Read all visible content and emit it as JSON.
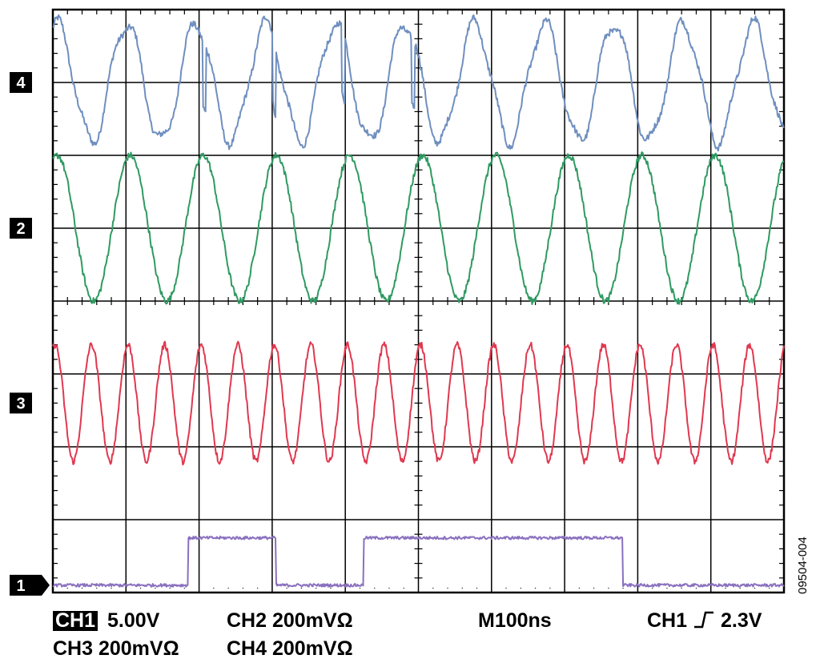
{
  "chart_data": {
    "type": "line",
    "instrument": "oscilloscope",
    "grid": true,
    "divisions": {
      "horizontal": 10,
      "vertical": 8
    },
    "series": [
      {
        "marker": "4",
        "color": "#6f8fbf",
        "waveform": "sine",
        "cycles_visible": 10.5,
        "amplitude_div": 0.8,
        "baseline_div": 7.0,
        "distortion": "glitches"
      },
      {
        "marker": "2",
        "color": "#2f9a62",
        "waveform": "sine",
        "cycles_visible": 10.0,
        "amplitude_div": 1.0,
        "baseline_div": 5.0
      },
      {
        "marker": "3",
        "color": "#e0384f",
        "waveform": "sine",
        "cycles_visible": 20.0,
        "amplitude_div": 0.8,
        "baseline_div": 2.6
      },
      {
        "marker": "1",
        "color": "#8a70bf",
        "waveform": "digital",
        "transitions_div": [
          [
            0.0,
            0
          ],
          [
            1.85,
            1
          ],
          [
            3.05,
            0
          ],
          [
            4.25,
            1
          ],
          [
            7.8,
            0
          ],
          [
            10.0,
            0
          ]
        ],
        "low_div": 0.1,
        "high_div": 0.75
      }
    ]
  },
  "readouts": {
    "ch1_badge": "CH1",
    "ch1_scale": "5.00V",
    "ch2": "CH2  200mVΩ",
    "timebase": "M100ns",
    "trigger_channel": "CH1",
    "trigger_level": "2.3V",
    "ch3": "CH3  200mVΩ",
    "ch4": "CH4  200mVΩ"
  },
  "figure_id": "09504-004",
  "colors": {
    "grid": "#000000",
    "background": "#ffffff"
  },
  "icons": {
    "trigger": "rising-edge-icon",
    "ground": "ground-arrow-icon"
  }
}
